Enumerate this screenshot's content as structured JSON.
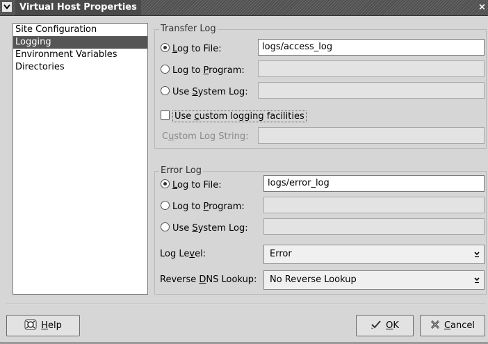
{
  "window": {
    "title": "Virtual Host Properties",
    "close_glyph": "×"
  },
  "sidebar": {
    "items": [
      {
        "label": "Site Configuration",
        "selected": false
      },
      {
        "label": "Logging",
        "selected": true
      },
      {
        "label": "Environment Variables",
        "selected": false
      },
      {
        "label": "Directories",
        "selected": false
      }
    ]
  },
  "transfer_log": {
    "title": "Transfer Log",
    "log_to_file": {
      "pre": "",
      "mn": "L",
      "post": "og to File:",
      "checked": true,
      "value": "logs/access_log"
    },
    "log_to_program": {
      "pre": "Log to ",
      "mn": "P",
      "post": "rogram:",
      "checked": false,
      "value": ""
    },
    "use_system_log": {
      "pre": "Use ",
      "mn": "S",
      "post": "ystem Log:",
      "checked": false,
      "value": ""
    },
    "custom_logging": {
      "pre": "Use ",
      "mn": "c",
      "post": "ustom logging facilities",
      "checked": false
    },
    "custom_log_string": {
      "pre": "C",
      "mn": "u",
      "post": "stom Log String:",
      "value": ""
    }
  },
  "error_log": {
    "title": "Error Log",
    "log_to_file": {
      "pre": "",
      "mn": "L",
      "post": "og to File:",
      "checked": true,
      "value": "logs/error_log"
    },
    "log_to_program": {
      "pre": "Log to ",
      "mn": "P",
      "post": "rogram:",
      "checked": false,
      "value": ""
    },
    "use_system_log": {
      "pre": "Use ",
      "mn": "S",
      "post": "ystem Log:",
      "checked": false,
      "value": ""
    },
    "log_level": {
      "pre": "Log Le",
      "mn": "v",
      "post": "el:",
      "value": "Error"
    },
    "reverse_dns": {
      "pre": "Reverse ",
      "mn": "D",
      "post": "NS Lookup:",
      "value": "No Reverse Lookup"
    }
  },
  "buttons": {
    "help": {
      "mn": "H",
      "post": "elp",
      "icon": "help-icon"
    },
    "ok": {
      "mn": "O",
      "post": "K",
      "icon": "checkmark-icon"
    },
    "cancel": {
      "mn": "C",
      "post": "ancel",
      "icon": "cancel-x-icon"
    }
  }
}
